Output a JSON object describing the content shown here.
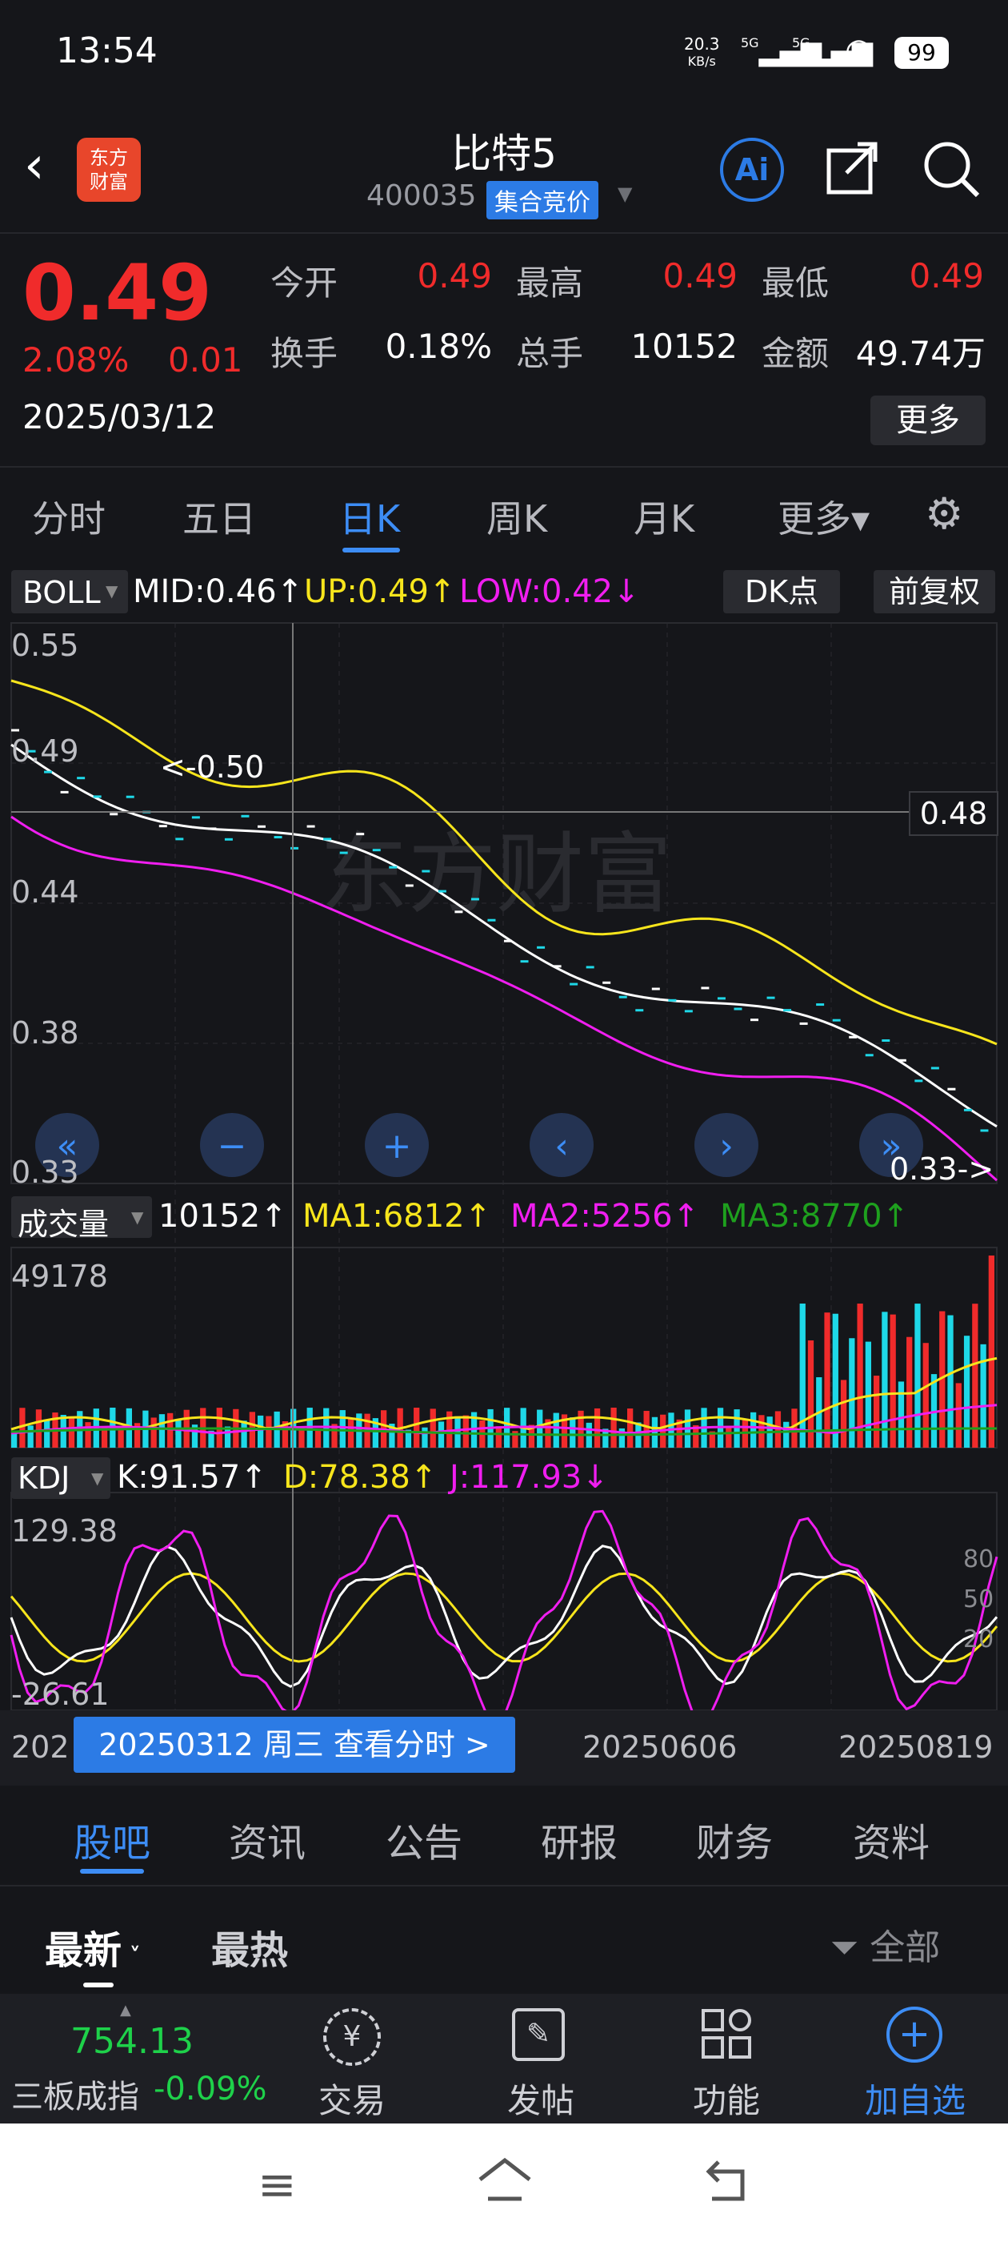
{
  "status_bar": {
    "time": "13:54",
    "net_speed": "20.3",
    "net_unit": "KB/s",
    "sig1": "5G",
    "sig2": "5G",
    "battery": "99"
  },
  "header": {
    "logo_line1": "东方",
    "logo_line2": "财富",
    "stock_name": "比特5",
    "stock_code": "400035",
    "badge": "集合竞价"
  },
  "quote": {
    "price": "0.49",
    "change_pct": "2.08%",
    "change": "0.01",
    "date": "2025/03/12",
    "open_label": "今开",
    "open": "0.49",
    "high_label": "最高",
    "high": "0.49",
    "low_label": "最低",
    "low": "0.49",
    "turnover_label": "换手",
    "turnover": "0.18%",
    "volume_label": "总手",
    "volume": "10152",
    "amount_label": "金额",
    "amount": "49.74万",
    "more": "更多"
  },
  "tabs": [
    "分时",
    "五日",
    "日K",
    "周K",
    "月K",
    "更多▾"
  ],
  "boll": {
    "name": "BOLL",
    "mid": "MID:0.46↑",
    "up": "UP:0.49↑",
    "low": "LOW:0.42↓",
    "dk": "DK点",
    "fq": "前复权",
    "y_labels": [
      "0.55",
      "0.49",
      "0.44",
      "0.38",
      "0.33"
    ],
    "crosshair": "0.48",
    "marker": "<-0.50",
    "last_marker": "0.33->"
  },
  "volume": {
    "name": "成交量",
    "value": "10152↑",
    "ma1": "MA1:6812↑",
    "ma2": "MA2:5256↑",
    "ma3": "MA3:8770↑",
    "ymax": "49178"
  },
  "kdj": {
    "name": "KDJ",
    "k": "K:91.57↑",
    "d": "D:78.38↑",
    "j": "J:117.93↓",
    "ymax": "129.38",
    "ymin": "-26.61",
    "levels": [
      "80",
      "50",
      "20"
    ]
  },
  "dates": {
    "left": "202",
    "mid": "20250606",
    "right": "20250819",
    "tooltip": "20250312 周三 查看分时 >"
  },
  "colors": {
    "up": "#f02b2b",
    "accent": "#3d8df5",
    "yellow": "#f7e51c",
    "magenta": "#f01ef0",
    "green": "#1ea01e",
    "cyan": "#1ed8e8"
  },
  "bottom_tabs": [
    "股吧",
    "资讯",
    "公告",
    "研报",
    "财务",
    "资料"
  ],
  "sort": {
    "latest": "最新",
    "hot": "最热",
    "filter": "全部"
  },
  "toolbar": {
    "index_value": "754.13",
    "index_name": "三板成指",
    "index_change": "-0.09%",
    "trade": "交易",
    "post": "发帖",
    "func": "功能",
    "add": "加自选"
  }
}
